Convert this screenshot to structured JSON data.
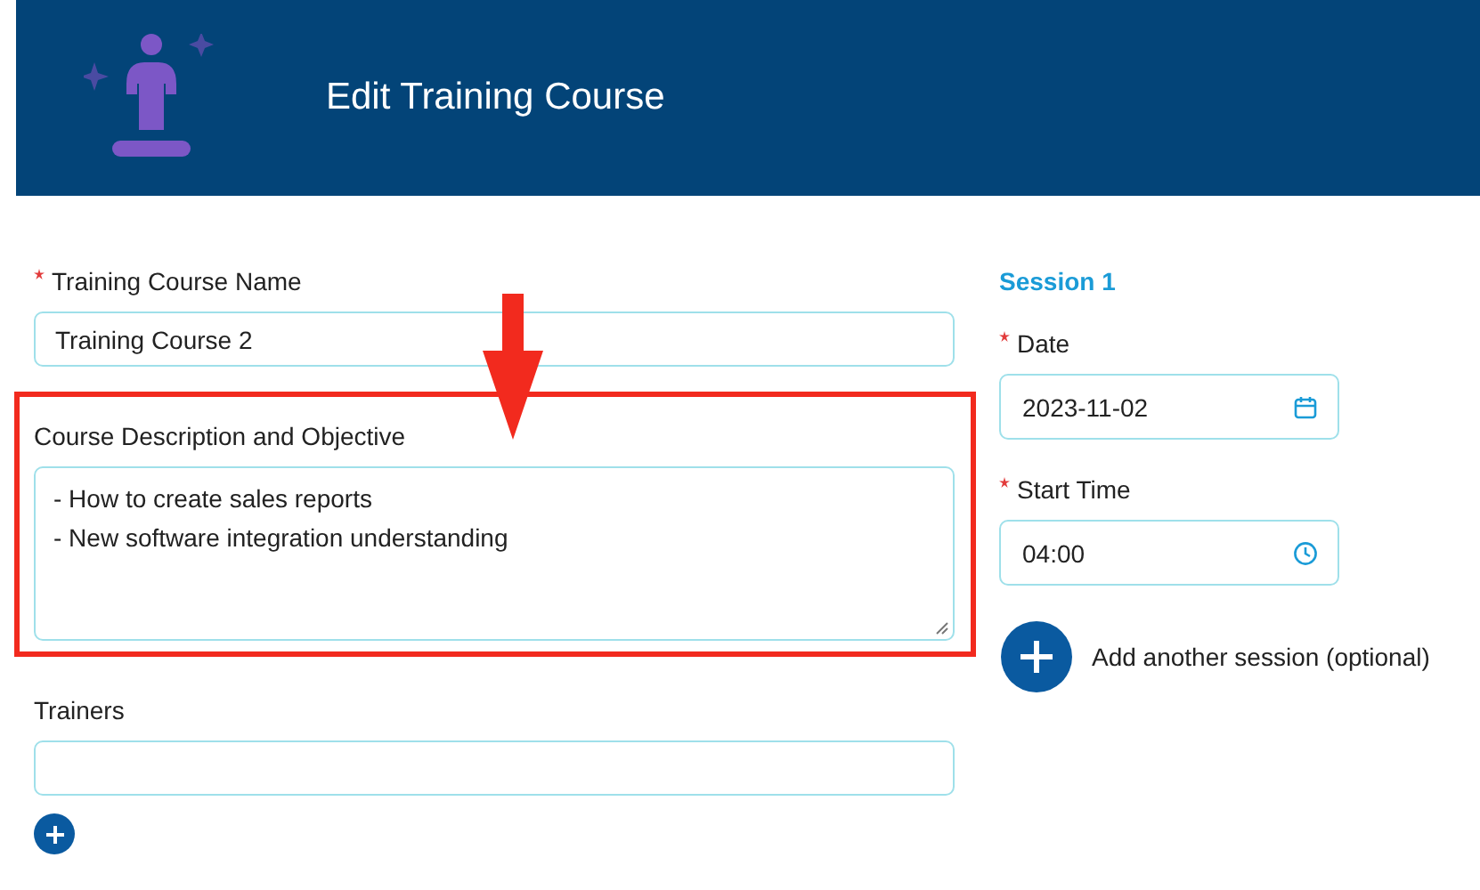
{
  "header": {
    "title": "Edit Training Course"
  },
  "left_fields": [
    {
      "kind": "input",
      "label": "Training Course Name",
      "required": true,
      "value": "Training Course 2",
      "highlighted": false
    },
    {
      "kind": "textarea",
      "label": "Course Description and Objective",
      "required": false,
      "lines": [
        "- How to create sales reports",
        "- New software integration understanding"
      ],
      "highlighted": true
    },
    {
      "kind": "input",
      "label": "Trainers",
      "required": false,
      "highlighted": false,
      "add_button": true
    }
  ],
  "session": {
    "title": "Session 1",
    "fields": [
      {
        "kind": "date",
        "label": "Date",
        "required": true,
        "value": "2023-11-02"
      },
      {
        "kind": "time",
        "label": "Start Time",
        "required": true,
        "value": "04:00"
      }
    ],
    "add_label": "Add another session (optional)"
  }
}
